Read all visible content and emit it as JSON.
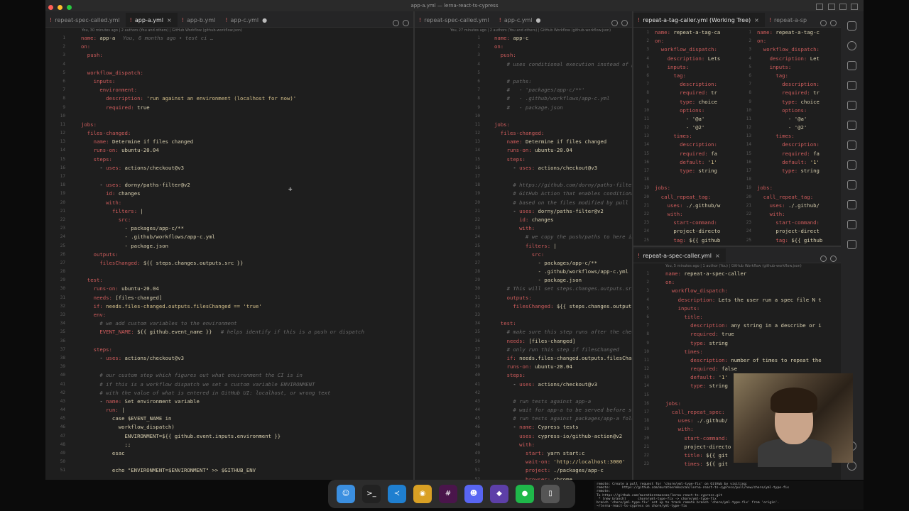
{
  "window": {
    "title": "app-a.yml — lerna-react-ts-cypress"
  },
  "pane1": {
    "tabs": [
      {
        "label": "repeat-spec-called.yml",
        "state": ""
      },
      {
        "label": "app-a.yml",
        "state": "close"
      },
      {
        "label": "app-b.yml",
        "state": ""
      },
      {
        "label": "app-c.yml",
        "state": "dot"
      }
    ],
    "blame": "You, 30 minutes ago | 2 authors (You and others) | GitHub Workflow (github-workflow.json)",
    "lines": [
      {
        "n": "1",
        "t": "name: app-a",
        "c": "You, 6 months ago • test ci …"
      },
      {
        "n": "2",
        "t": "on:"
      },
      {
        "n": "3",
        "t": "  push:"
      },
      {
        "n": "4",
        "t": ""
      },
      {
        "n": "5",
        "t": "  workflow_dispatch:"
      },
      {
        "n": "6",
        "t": "    inputs:"
      },
      {
        "n": "7",
        "t": "      environment:"
      },
      {
        "n": "8",
        "t": "        description: 'run against an environment (localhost for now)'"
      },
      {
        "n": "9",
        "t": "        required: true"
      },
      {
        "n": "10",
        "t": ""
      },
      {
        "n": "11",
        "t": "jobs:"
      },
      {
        "n": "12",
        "t": "  files-changed:"
      },
      {
        "n": "13",
        "t": "    name: Determine if files changed"
      },
      {
        "n": "14",
        "t": "    runs-on: ubuntu-20.04"
      },
      {
        "n": "15",
        "t": "    steps:"
      },
      {
        "n": "16",
        "t": "      - uses: actions/checkout@v3"
      },
      {
        "n": "17",
        "t": ""
      },
      {
        "n": "18",
        "t": "      - uses: dorny/paths-filter@v2"
      },
      {
        "n": "19",
        "t": "        id: changes"
      },
      {
        "n": "20",
        "t": "        with:"
      },
      {
        "n": "21",
        "t": "          filters: |"
      },
      {
        "n": "22",
        "t": "            src:"
      },
      {
        "n": "23",
        "t": "              - packages/app-c/**"
      },
      {
        "n": "24",
        "t": "              - .github/workflows/app-c.yml"
      },
      {
        "n": "25",
        "t": "              - package.json"
      },
      {
        "n": "26",
        "t": "    outputs:"
      },
      {
        "n": "27",
        "t": "      filesChanged: ${{ steps.changes.outputs.src }}"
      },
      {
        "n": "28",
        "t": ""
      },
      {
        "n": "29",
        "t": "  test:"
      },
      {
        "n": "30",
        "t": "    runs-on: ubuntu-20.04"
      },
      {
        "n": "31",
        "t": "    needs: [files-changed]"
      },
      {
        "n": "32",
        "t": "    if: needs.files-changed.outputs.filesChanged == 'true'"
      },
      {
        "n": "33",
        "t": "    env:"
      },
      {
        "n": "34",
        "t": "      # we add custom variables to the environment",
        "cm": true
      },
      {
        "n": "35",
        "t": "      EVENT_NAME: ${{ github.event_name }}",
        "c": "# helps identify if this is a push or dispatch"
      },
      {
        "n": "36",
        "t": ""
      },
      {
        "n": "37",
        "t": "    steps:"
      },
      {
        "n": "38",
        "t": "      - uses: actions/checkout@v3"
      },
      {
        "n": "39",
        "t": ""
      },
      {
        "n": "40",
        "t": "      # our custom step which figures out what environment the CI is in",
        "cm": true
      },
      {
        "n": "41",
        "t": "      # if this is a workflow dispatch we set a custom variable ENVIRONMENT",
        "cm": true
      },
      {
        "n": "42",
        "t": "      # with the value of what is entered in GitHub UI: localhost, or wrong text",
        "cm": true
      },
      {
        "n": "43",
        "t": "      - name: Set environment variable"
      },
      {
        "n": "44",
        "t": "        run: |"
      },
      {
        "n": "45",
        "t": "          case $EVENT_NAME in"
      },
      {
        "n": "46",
        "t": "            workflow_dispatch)"
      },
      {
        "n": "47",
        "t": "              ENVIRONMENT=${{ github.event.inputs.environment }}"
      },
      {
        "n": "48",
        "t": "              ;;"
      },
      {
        "n": "49",
        "t": "          esac"
      },
      {
        "n": "50",
        "t": ""
      },
      {
        "n": "51",
        "t": "          echo \"ENVIRONMENT=$ENVIRONMENT\" >> $GITHUB_ENV"
      }
    ]
  },
  "pane2": {
    "tabs": [
      {
        "label": "repeat-spec-called.yml",
        "state": ""
      },
      {
        "label": "app-c.yml",
        "state": "dot"
      }
    ],
    "blame": "You, 27 minutes ago | 2 authors (You and others) | GitHub Workflow (github-workflow.json)",
    "lines": [
      {
        "n": "1",
        "t": "name: app-c"
      },
      {
        "n": "2",
        "t": "on:"
      },
      {
        "n": "3",
        "t": "  push:"
      },
      {
        "n": "4",
        "t": "    # uses conditional execution instead of push/pat",
        "cm": true
      },
      {
        "n": "5",
        "t": ""
      },
      {
        "n": "6",
        "t": "    # paths:",
        "cm": true
      },
      {
        "n": "7",
        "t": "    #   - 'packages/app-c/**'",
        "cm": true
      },
      {
        "n": "8",
        "t": "    #   - .github/workflows/app-c.yml",
        "cm": true
      },
      {
        "n": "9",
        "t": "    #   - package.json",
        "cm": true
      },
      {
        "n": "10",
        "t": ""
      },
      {
        "n": "11",
        "t": "jobs:"
      },
      {
        "n": "12",
        "t": "  files-changed:"
      },
      {
        "n": "13",
        "t": "    name: Determine if files changed"
      },
      {
        "n": "14",
        "t": "    runs-on: ubuntu-20.04"
      },
      {
        "n": "15",
        "t": "    steps:"
      },
      {
        "n": "16",
        "t": "      - uses: actions/checkout@v3"
      },
      {
        "n": "17",
        "t": ""
      },
      {
        "n": "18",
        "t": "      # https://github.com/dorny/paths-filter",
        "cm": true
      },
      {
        "n": "19",
        "t": "      # GitHub Action that enables conditional execu",
        "cm": true
      },
      {
        "n": "20",
        "t": "      # based on the files modified by pull request",
        "cm": true
      },
      {
        "n": "21",
        "t": "      - uses: dorny/paths-filter@v2"
      },
      {
        "n": "22",
        "t": "        id: changes"
      },
      {
        "n": "23",
        "t": "        with:"
      },
      {
        "n": "24",
        "t": "          # we copy the push/paths to here instead",
        "cm": true
      },
      {
        "n": "25",
        "t": "          filters: |"
      },
      {
        "n": "26",
        "t": "            src:"
      },
      {
        "n": "27",
        "t": "              - packages/app-c/**"
      },
      {
        "n": "28",
        "t": "              - .github/workflows/app-c.yml"
      },
      {
        "n": "29",
        "t": "              - package.json"
      },
      {
        "n": "30",
        "t": "    # This will set steps.changes.outputs.src to tru",
        "cm": true
      },
      {
        "n": "31",
        "t": "    outputs:"
      },
      {
        "n": "32",
        "t": "      filesChanged: ${{ steps.changes.outputs.src }}"
      },
      {
        "n": "33",
        "t": ""
      },
      {
        "n": "34",
        "t": "  test:"
      },
      {
        "n": "35",
        "t": "    # make sure this step runs after the check for f",
        "cm": true
      },
      {
        "n": "36",
        "t": "    needs: [files-changed]"
      },
      {
        "n": "37",
        "t": "    # only run this step if filesChanged",
        "cm": true
      },
      {
        "n": "38",
        "t": "    if: needs.files-changed.outputs.filesChanged =="
      },
      {
        "n": "39",
        "t": "    runs-on: ubuntu-20.04"
      },
      {
        "n": "40",
        "t": "    steps:"
      },
      {
        "n": "41",
        "t": "      - uses: actions/checkout@v3"
      },
      {
        "n": "42",
        "t": ""
      },
      {
        "n": "43",
        "t": "      # run tests against app-a",
        "cm": true
      },
      {
        "n": "44",
        "t": "      # wait for app-a to be served before starting",
        "cm": true
      },
      {
        "n": "45",
        "t": "      # run tests against packages/app-a folder",
        "cm": true
      },
      {
        "n": "46",
        "t": "      - name: Cypress tests"
      },
      {
        "n": "47",
        "t": "        uses: cypress-io/github-action@v2"
      },
      {
        "n": "48",
        "t": "        with:"
      },
      {
        "n": "49",
        "t": "          start: yarn start:c"
      },
      {
        "n": "50",
        "t": "          wait-on: 'http://localhost:3000'"
      },
      {
        "n": "51",
        "t": "          project: ./packages/app-c"
      },
      {
        "n": "52",
        "t": "          browser: chrome"
      }
    ]
  },
  "pane3": {
    "tabs": [
      {
        "label": "repeat-a-tag-caller.yml (Working Tree)",
        "state": "close"
      },
      {
        "label": "repeat-a-sp",
        "state": ""
      }
    ],
    "left_lines": [
      {
        "n": "1",
        "t": "name: repeat-a-tag-ca"
      },
      {
        "n": "2",
        "t": "on:"
      },
      {
        "n": "3",
        "t": "  workflow_dispatch:"
      },
      {
        "n": "4",
        "t": "    description: Lets"
      },
      {
        "n": "5",
        "t": "    inputs:"
      },
      {
        "n": "6",
        "t": "      tag:"
      },
      {
        "n": "7",
        "t": "        description:"
      },
      {
        "n": "8",
        "t": "        required: tr"
      },
      {
        "n": "9",
        "t": "        type: choice"
      },
      {
        "n": "10",
        "t": "        options:"
      },
      {
        "n": "11",
        "t": "          - '@a'"
      },
      {
        "n": "12",
        "t": "          - '@2'"
      },
      {
        "n": "13",
        "t": "      times:"
      },
      {
        "n": "14",
        "t": "        description:"
      },
      {
        "n": "15",
        "t": "        required: fa"
      },
      {
        "n": "16",
        "t": "        default: '1'"
      },
      {
        "n": "17",
        "t": "        type: string"
      },
      {
        "n": "18",
        "t": ""
      },
      {
        "n": "19",
        "t": "jobs:"
      },
      {
        "n": "20",
        "t": "  call_repeat_tag:"
      },
      {
        "n": "21",
        "t": "    uses: ./.github/w"
      },
      {
        "n": "22",
        "t": "    with:"
      },
      {
        "n": "23",
        "t": "      start-command:"
      },
      {
        "n": "24",
        "t": "      project-directo"
      },
      {
        "n": "25",
        "t": "      tag: ${{ github"
      }
    ],
    "right_lines": [
      {
        "n": "1",
        "t": "name: repeat-a-tag-c"
      },
      {
        "n": "2",
        "t": "on:"
      },
      {
        "n": "3",
        "t": "  workflow_dispatch:"
      },
      {
        "n": "4",
        "t": "    description: Let"
      },
      {
        "n": "5",
        "t": "    inputs:"
      },
      {
        "n": "6",
        "t": "      tag:"
      },
      {
        "n": "7",
        "t": "        description:"
      },
      {
        "n": "8",
        "t": "        required: tr"
      },
      {
        "n": "9",
        "t": "        type: choice"
      },
      {
        "n": "10",
        "t": "        options:"
      },
      {
        "n": "11",
        "t": "          - '@a'"
      },
      {
        "n": "12",
        "t": "          - '@2'"
      },
      {
        "n": "13",
        "t": "      times:"
      },
      {
        "n": "14",
        "t": "        description:"
      },
      {
        "n": "15",
        "t": "        required: fa"
      },
      {
        "n": "16",
        "t": "        default: '1'"
      },
      {
        "n": "17",
        "t": "        type: string"
      },
      {
        "n": "18",
        "t": ""
      },
      {
        "n": "19",
        "t": "jobs:"
      },
      {
        "n": "20",
        "t": "  call_repeat_tag:"
      },
      {
        "n": "21",
        "t": "    uses: ./.github/"
      },
      {
        "n": "22",
        "t": "    with:"
      },
      {
        "n": "23",
        "t": "      start-command:"
      },
      {
        "n": "24",
        "t": "      project-direct"
      },
      {
        "n": "25",
        "t": "      tag: ${{ github"
      }
    ]
  },
  "pane4": {
    "tabs": [
      {
        "label": "repeat-a-spec-caller.yml",
        "state": "close"
      }
    ],
    "blame": "You, 5 minutes ago | 1 author (You) | GitHub Workflow (github-workflow.json)",
    "lines": [
      {
        "n": "1",
        "t": "name: repeat-a-spec-caller"
      },
      {
        "n": "2",
        "t": "on:"
      },
      {
        "n": "3",
        "t": "  workflow_dispatch:"
      },
      {
        "n": "4",
        "t": "    description: Lets the user run a spec file N t"
      },
      {
        "n": "5",
        "t": "    inputs:"
      },
      {
        "n": "6",
        "t": "      title:"
      },
      {
        "n": "7",
        "t": "        description: any string in a describe or i"
      },
      {
        "n": "8",
        "t": "        required: true"
      },
      {
        "n": "9",
        "t": "        type: string"
      },
      {
        "n": "10",
        "t": "      times:"
      },
      {
        "n": "11",
        "t": "        description: number of times to repeat the"
      },
      {
        "n": "12",
        "t": "        required: false"
      },
      {
        "n": "13",
        "t": "        default: '1'"
      },
      {
        "n": "14",
        "t": "        type: string"
      },
      {
        "n": "15",
        "t": ""
      },
      {
        "n": "16",
        "t": "jobs:"
      },
      {
        "n": "17",
        "t": "  call_repeat_spec:"
      },
      {
        "n": "18",
        "t": "    uses: ./.github/"
      },
      {
        "n": "19",
        "t": "    with:"
      },
      {
        "n": "20",
        "t": "      start-command:"
      },
      {
        "n": "21",
        "t": "      project-directo"
      },
      {
        "n": "22",
        "t": "      title: ${{ git"
      },
      {
        "n": "23",
        "t": "      times: ${{ git"
      }
    ]
  },
  "terminal": {
    "lines": [
      "remote: Create a pull request for 'chore/yml-type-fix' on GitHub by visiting:",
      "remote:      https://github.com/muratkeremozcan/lerna-react-ts-cypress/pull/new/chore/yml-type-fix",
      "remote:",
      "To https://github.com/muratkeremozcan/lerna-react-ts-cypress.git",
      " * [new branch]      chore/yml-type-fix -> chore/yml-type-fix",
      "branch 'chore/yml-type-fix' set up to track remote branch 'chore/yml-type-fix' from 'origin'.",
      "~/lerna-react-ts-cypress on chore/yml-type-fix"
    ]
  },
  "dock": {
    "apps": [
      {
        "name": "finder",
        "glyph": "☺",
        "color": "#3b8fe0"
      },
      {
        "name": "terminal",
        "glyph": ">_",
        "color": "#222222"
      },
      {
        "name": "vscode",
        "glyph": "≺",
        "color": "#1f7fd0"
      },
      {
        "name": "chrome",
        "glyph": "◉",
        "color": "#d9a024"
      },
      {
        "name": "slack",
        "glyph": "#",
        "color": "#4a154b"
      },
      {
        "name": "discord",
        "glyph": "☻",
        "color": "#5865f2"
      },
      {
        "name": "obsidian",
        "glyph": "◆",
        "color": "#5d3fa8"
      },
      {
        "name": "cypress",
        "glyph": "●",
        "color": "#1fb84a"
      },
      {
        "name": "trash",
        "glyph": "▯",
        "color": "#555555"
      }
    ]
  }
}
